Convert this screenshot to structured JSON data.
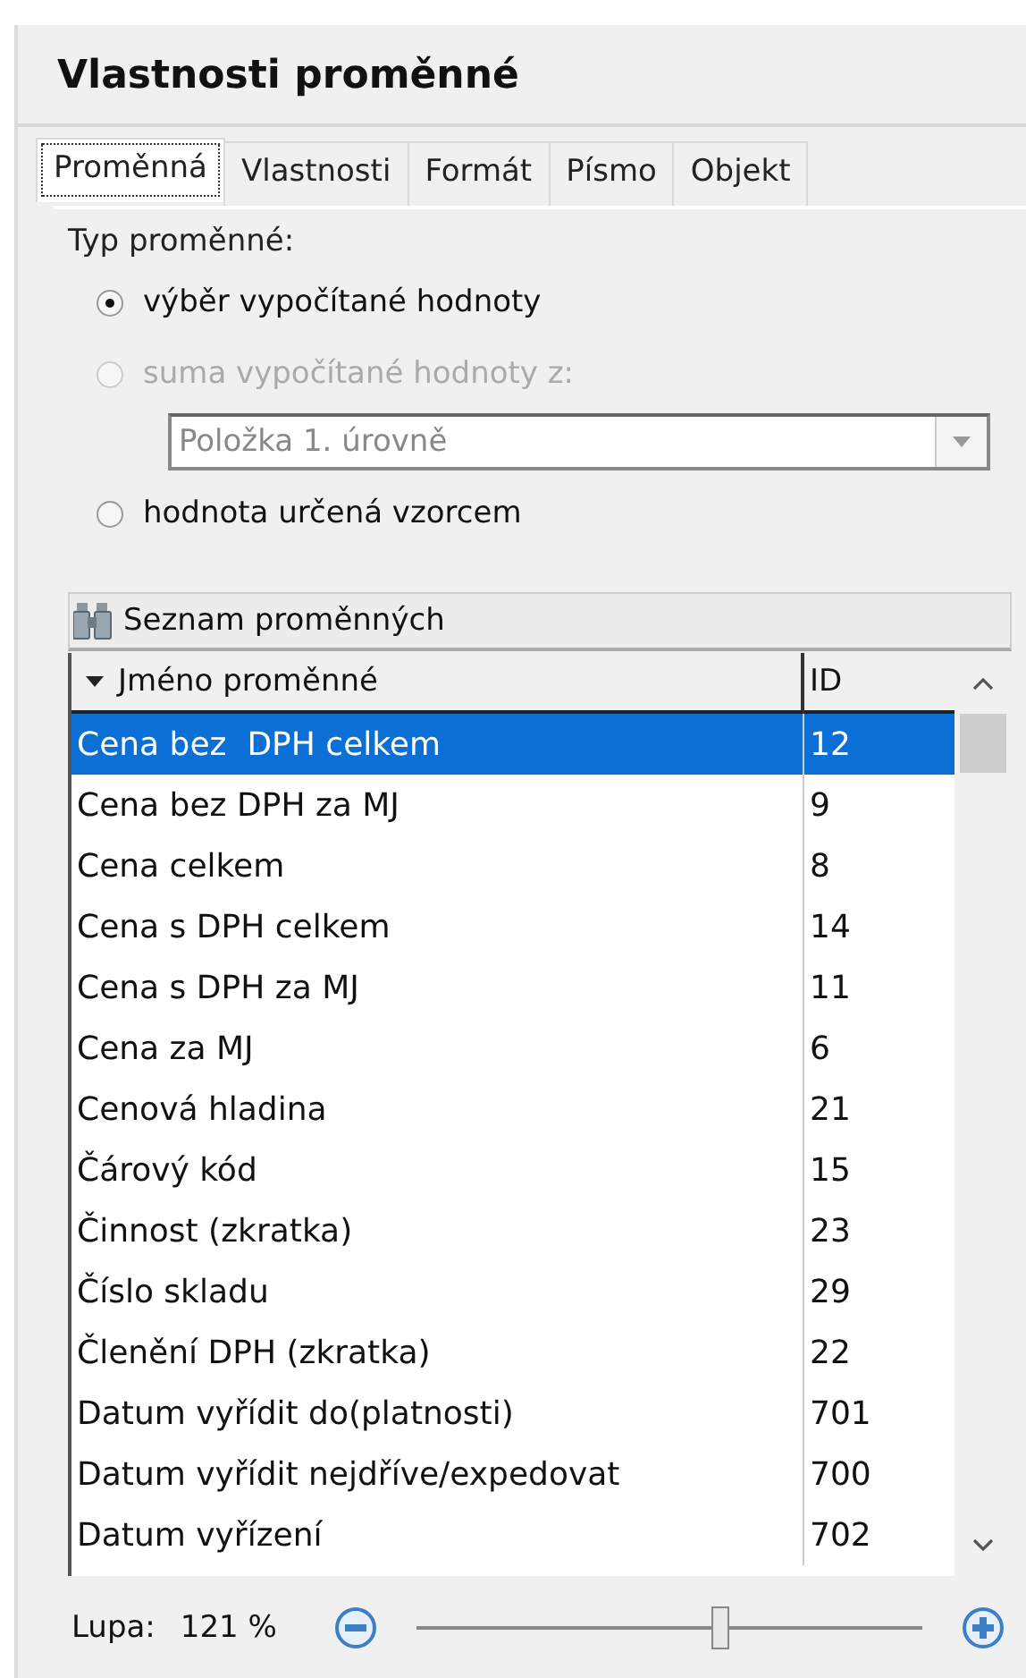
{
  "window": {
    "title": "Vlastnosti proměnné"
  },
  "tabs": [
    {
      "label": "Proměnná",
      "selected": true
    },
    {
      "label": "Vlastnosti",
      "selected": false
    },
    {
      "label": "Formát",
      "selected": false
    },
    {
      "label": "Písmo",
      "selected": false
    },
    {
      "label": "Objekt",
      "selected": false
    }
  ],
  "variable_type": {
    "label": "Typ proměnné:",
    "options": [
      {
        "label": "výběr vypočítané hodnoty",
        "selected": true,
        "disabled": false
      },
      {
        "label": "suma vypočítané hodnoty z:",
        "selected": false,
        "disabled": true,
        "dropdown": {
          "value": "Položka 1. úrovně",
          "disabled": true
        }
      },
      {
        "label": "hodnota určená vzorcem",
        "selected": false,
        "disabled": false
      }
    ]
  },
  "variable_list": {
    "title": "Seznam proměnných",
    "columns": [
      "Jméno proměnné",
      "ID"
    ],
    "rows": [
      {
        "name": "Cena bez  DPH celkem",
        "id": "12",
        "selected": true
      },
      {
        "name": "Cena bez DPH za MJ",
        "id": "9",
        "selected": false
      },
      {
        "name": "Cena celkem",
        "id": "8",
        "selected": false
      },
      {
        "name": "Cena s DPH celkem",
        "id": "14",
        "selected": false
      },
      {
        "name": "Cena s DPH za MJ",
        "id": "11",
        "selected": false
      },
      {
        "name": "Cena za MJ",
        "id": "6",
        "selected": false
      },
      {
        "name": "Cenová hladina",
        "id": "21",
        "selected": false
      },
      {
        "name": "Čárový kód",
        "id": "15",
        "selected": false
      },
      {
        "name": "Činnost (zkratka)",
        "id": "23",
        "selected": false
      },
      {
        "name": "Číslo skladu",
        "id": "29",
        "selected": false
      },
      {
        "name": "Členění DPH (zkratka)",
        "id": "22",
        "selected": false
      },
      {
        "name": "Datum vyřídit do(platnosti)",
        "id": "701",
        "selected": false
      },
      {
        "name": "Datum vyřídit nejdříve/expedovat",
        "id": "700",
        "selected": false
      },
      {
        "name": "Datum vyřízení",
        "id": "702",
        "selected": false
      }
    ]
  },
  "zoom": {
    "label": "Lupa:",
    "reading": "121 %",
    "level": 0.6
  }
}
